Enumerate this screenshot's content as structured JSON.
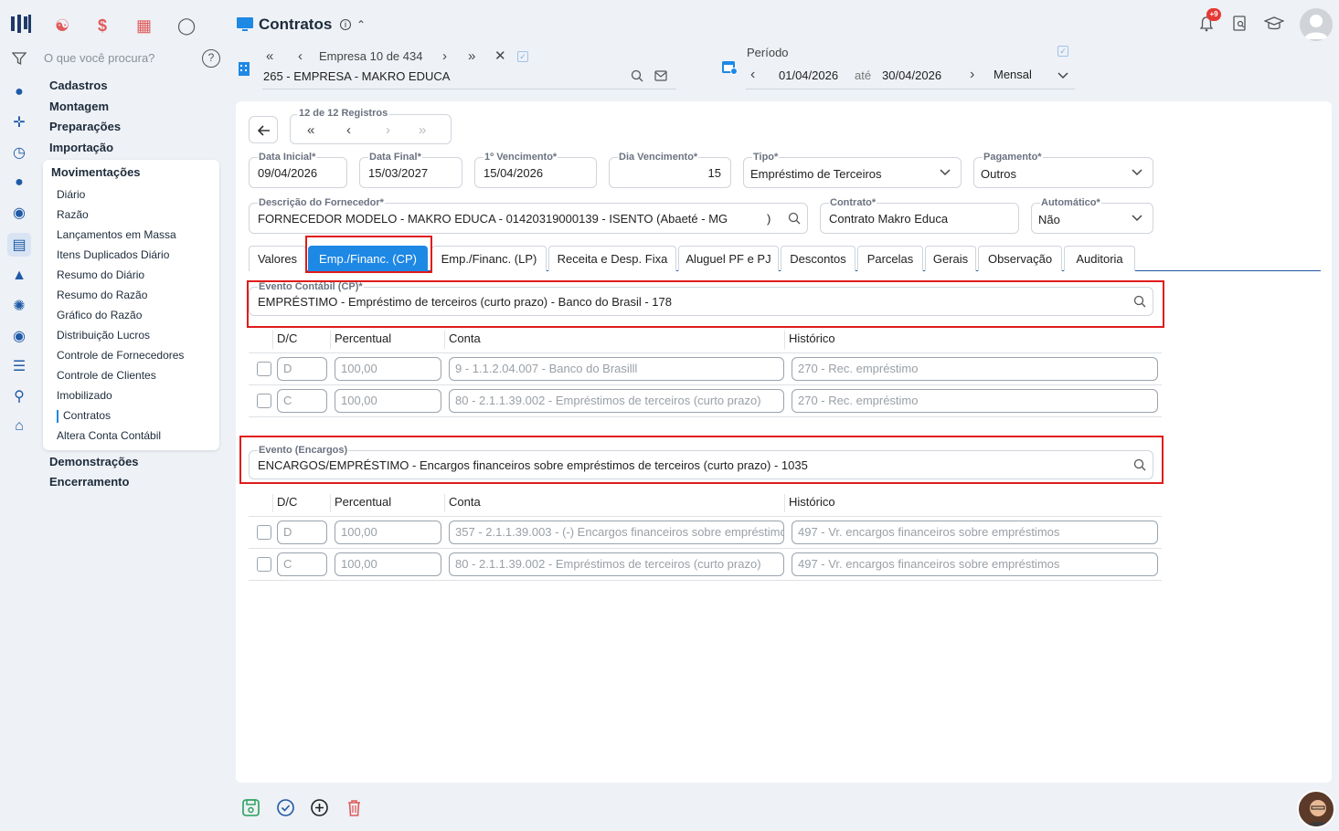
{
  "app": {
    "title": "Contratos"
  },
  "search": {
    "placeholder": "O que você procura?"
  },
  "menu": {
    "headers": [
      "Cadastros",
      "Montagem",
      "Preparações",
      "Importação",
      "Movimentações",
      "Demonstrações",
      "Encerramento"
    ],
    "sub_items": [
      "Diário",
      "Razão",
      "Lançamentos em Massa",
      "Itens Duplicados Diário",
      "Resumo do Diário",
      "Resumo do Razão",
      "Gráfico do Razão",
      "Distribuição Lucros",
      "Controle de Fornecedores",
      "Controle de Clientes",
      "Imobilizado",
      "Contratos",
      "Altera Conta Contábil"
    ]
  },
  "company_nav": {
    "label": "Empresa 10 de 434",
    "selected": "265 - EMPRESA - MAKRO EDUCA"
  },
  "period": {
    "label": "Período",
    "start": "01/04/2026",
    "separator": "até",
    "end": "30/04/2026",
    "mode": "Mensal"
  },
  "notifications": {
    "badge": "+9"
  },
  "records": {
    "label": "12 de 12 Registros"
  },
  "form": {
    "data_inicial": {
      "label": "Data Inicial*",
      "value": "09/04/2026"
    },
    "data_final": {
      "label": "Data Final*",
      "value": "15/03/2027"
    },
    "primeiro_venc": {
      "label": "1º Vencimento*",
      "value": "15/04/2026"
    },
    "dia_venc": {
      "label": "Dia Vencimento*",
      "value": "15"
    },
    "tipo": {
      "label": "Tipo*",
      "value": "Empréstimo de Terceiros"
    },
    "pagamento": {
      "label": "Pagamento*",
      "value": "Outros"
    },
    "fornecedor": {
      "label": "Descrição do Fornecedor*",
      "value": "FORNECEDOR MODELO - MAKRO EDUCA - 01420319000139 - ISENTO (Abaeté - MG",
      ")": ")"
    },
    "contrato": {
      "label": "Contrato*",
      "value": "Contrato Makro Educa"
    },
    "automatico": {
      "label": "Automático*",
      "value": "Não"
    }
  },
  "tabs": [
    "Valores",
    "Emp./Financ. (CP)",
    "Emp./Financ. (LP)",
    "Receita e Desp. Fixa",
    "Aluguel PF e PJ",
    "Descontos",
    "Parcelas",
    "Gerais",
    "Observação",
    "Auditoria"
  ],
  "evento_cp": {
    "label": "Evento Contábil (CP)*",
    "value": "EMPRÉSTIMO - Empréstimo de terceiros (curto prazo) - Banco do Brasil - 178"
  },
  "evento_enc": {
    "label": "Evento (Encargos)",
    "value": "ENCARGOS/EMPRÉSTIMO - Encargos financeiros sobre empréstimos de terceiros (curto prazo) - 1035"
  },
  "columns": {
    "dc": "D/C",
    "percentual": "Percentual",
    "conta": "Conta",
    "historico": "Histórico"
  },
  "rows_cp": [
    {
      "dc": "D",
      "percentual": "100,00",
      "conta": "9 - 1.1.2.04.007 - Banco do Brasilll",
      "historico": "270 - Rec. empréstimo"
    },
    {
      "dc": "C",
      "percentual": "100,00",
      "conta": "80 - 2.1.1.39.002 - Empréstimos de terceiros (curto prazo)",
      "historico": "270 - Rec. empréstimo"
    }
  ],
  "rows_enc": [
    {
      "dc": "D",
      "percentual": "100,00",
      "conta": "357 - 2.1.1.39.003 - (-) Encargos financeiros sobre empréstimos",
      "historico": "497 - Vr. encargos financeiros sobre empréstimos"
    },
    {
      "dc": "C",
      "percentual": "100,00",
      "conta": "80 - 2.1.1.39.002 - Empréstimos de terceiros (curto prazo)",
      "historico": "497 - Vr. encargos financeiros sobre empréstimos"
    }
  ],
  "colors": {
    "accent": "#1e88e5",
    "highlight": "#e01b1b",
    "brand": "#1f3a68"
  }
}
